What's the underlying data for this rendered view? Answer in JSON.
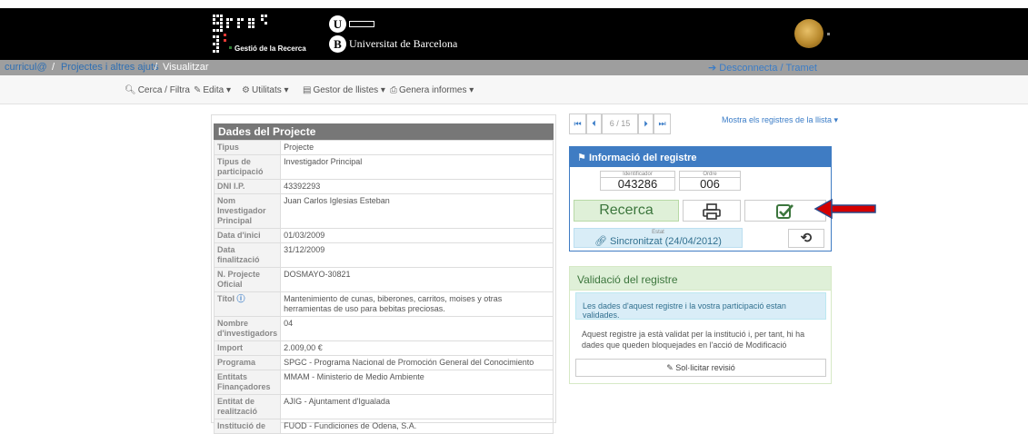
{
  "header": {
    "app_logo_text": "grec",
    "app_subtitle": "Gestió de la Recerca",
    "university_name": "Universitat de Barcelona",
    "university_letter_u": "U",
    "university_letter_b": "B"
  },
  "breadcrumb": {
    "root": "curricul@",
    "sep1": " / ",
    "section": "Projectes i altres ajuts",
    "sep2": " / ",
    "current": "Visualitzar",
    "logout": "➔ Desconnecta / Tramet"
  },
  "toolbar": {
    "search": "Cerca / Filtra",
    "edit": "Edita",
    "utils": "Utilitats",
    "lists": "Gestor de llistes",
    "reports": "Genera informes"
  },
  "project_panel": {
    "title": "Dades del Projecte",
    "rows": [
      {
        "key": "Tipus",
        "value": "Projecte"
      },
      {
        "key": "Tipus de participació",
        "value": "Investigador Principal"
      },
      {
        "key": "DNI I.P.",
        "value": "43392293"
      },
      {
        "key": "Nom Investigador Principal",
        "value": "Juan Carlos Iglesias Esteban"
      },
      {
        "key": "Data d'inici",
        "value": "01/03/2009"
      },
      {
        "key": "Data finalització",
        "value": "31/12/2009"
      },
      {
        "key": "N. Projecte Oficial",
        "value": "DOSMAYO-30821"
      },
      {
        "key": "Títol",
        "value": "Mantenimiento de cunas, biberones, carritos, moises y otras herramientas de uso para bebitas preciosas."
      },
      {
        "key": "Nombre d'investigadors",
        "value": "04"
      },
      {
        "key": "Import",
        "value": "2.009,00 €"
      },
      {
        "key": "Programa",
        "value": "SPGC - Programa Nacional de Promoción General del Conocimiento"
      },
      {
        "key": "Entitats Finançadores",
        "value": "MMAM - Ministerio de Medio Ambiente"
      },
      {
        "key": "Entitat de realització",
        "value": "AJIG - Ajuntament d'Igualada"
      },
      {
        "key": "Institució de",
        "value": "FUOD - Fundiciones de Odena, S.A."
      }
    ]
  },
  "pager": {
    "first": "⏮",
    "prev": "⏴",
    "position": "6 / 15",
    "next": "⏵",
    "last": "⏭",
    "show_all": "Mostra els registres de la llista"
  },
  "record_info": {
    "title": "Informació del registre",
    "id_label": "Identificador",
    "id_value": "043286",
    "order_label": "Ordre",
    "order_value": "006",
    "category": "Recerca",
    "status_label": "Estat",
    "status_value": "Sincronitzat (24/04/2012)"
  },
  "validation": {
    "title": "Validació del registre",
    "notice": "Les dades d'aquest registre i la vostra participació estan validades.",
    "text": "Aquest registre ja està validat per la institució i, per tant, hi ha dades que queden bloquejades en l'acció de Modificació",
    "button": "Sol·licitar revisió"
  },
  "colors": {
    "topbar": "#000000",
    "accent": "#3f7cc3",
    "success": "#dff0d8",
    "arrow": "#d40000"
  }
}
